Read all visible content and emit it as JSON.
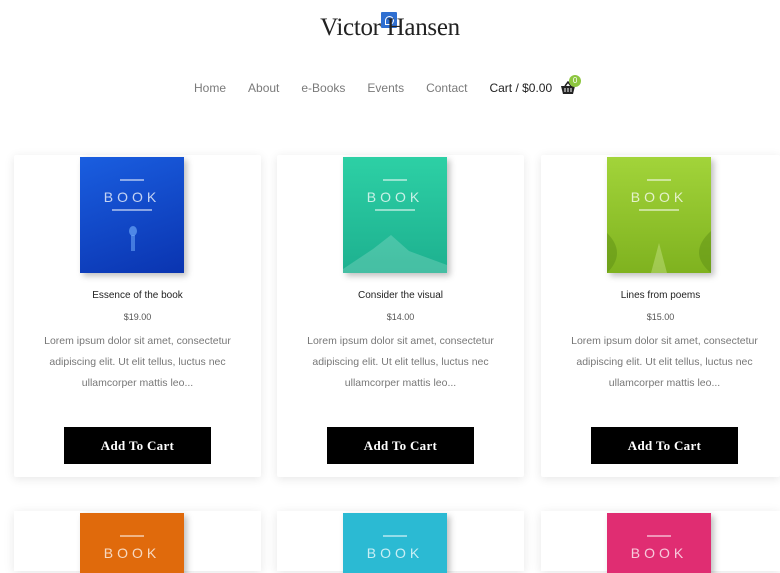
{
  "logo": {
    "text": "Victor Hansen"
  },
  "nav": {
    "items": [
      "Home",
      "About",
      "e-Books",
      "Events",
      "Contact"
    ],
    "cart_label": "Cart / $0.00",
    "cart_count": "0"
  },
  "products": [
    {
      "title": "Essence of the book",
      "price": "$19.00",
      "description": "Lorem ipsum dolor sit amet, consectetur adipiscing elit. Ut elit tellus, luctus nec ullamcorper mattis leo...",
      "button": "Add To Cart",
      "cover_text": "BOOK",
      "cover_color": "#1348c8"
    },
    {
      "title": "Consider the visual",
      "price": "$14.00",
      "description": "Lorem ipsum dolor sit amet, consectetur adipiscing elit. Ut elit tellus, luctus nec ullamcorper mattis leo...",
      "button": "Add To Cart",
      "cover_text": "BOOK",
      "cover_color": "#27c69a"
    },
    {
      "title": "Lines from poems",
      "price": "$15.00",
      "description": "Lorem ipsum dolor sit amet, consectetur adipiscing elit. Ut elit tellus, luctus nec ullamcorper mattis leo...",
      "button": "Add To Cart",
      "cover_text": "BOOK",
      "cover_color": "#93c52a"
    }
  ],
  "second_row": [
    {
      "cover_text": "BOOK",
      "cover_color": "#e06a0c"
    },
    {
      "cover_text": "BOOK",
      "cover_color": "#2bbad3"
    },
    {
      "cover_text": "BOOK",
      "cover_color": "#e02d72"
    }
  ]
}
